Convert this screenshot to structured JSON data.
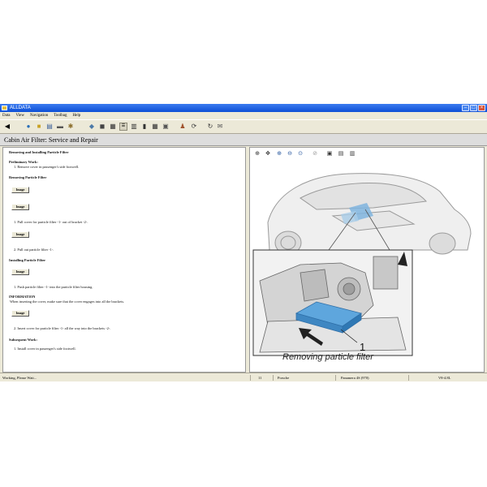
{
  "window": {
    "title": "ALLDATA"
  },
  "menu": [
    "Data",
    "View",
    "Navigation",
    "Toolbag",
    "Help"
  ],
  "toolbar": {
    "icons": [
      "back-arrow-icon",
      "globe-icon",
      "folder-icon",
      "book-icon",
      "car-icon",
      "gear-icon",
      "drive-icon",
      "camera-icon",
      "table-icon",
      "list-icon",
      "grid-icon",
      "pause-icon",
      "person-icon",
      "print-icon",
      "sync-icon",
      "mail-icon"
    ]
  },
  "document": {
    "title": "Cabin Air Filter:  Service and Repair",
    "heading": "Removing and Installing Particle Filter",
    "prelim_title": "Preliminary Work:",
    "prelim_step": "1.   Remove cover in passenger's side footwell.",
    "removing_title": "Removing Particle Filter",
    "image_label": "Image",
    "remove_step1": "1.   Pull cover for particle filter -1- out of bracket -2-.",
    "remove_step2": "2.   Pull out particle filter -1-.",
    "installing_title": "Installing Particle Filter",
    "install_step1": "1.   Push particle filter -1- into the particle filter housing.",
    "info_title": "INFORMATION",
    "info_text": "When inserting the cover, make sure that the cover engages into all the brackets.",
    "install_step2": "2.   Insert cover for particle filter -1- all the way into the brackets -2-.",
    "subsequent_title": "Subsequent Work:",
    "subsequent_step": "1.   Install cover in passenger's side footwell."
  },
  "figure": {
    "caption": "Removing particle filter",
    "callout": "1"
  },
  "status": {
    "message": "Working, Please Wait...",
    "page": "11",
    "make": "Porsche",
    "model": "Panamera 4S (970)",
    "engine": "V8-4.8L"
  }
}
